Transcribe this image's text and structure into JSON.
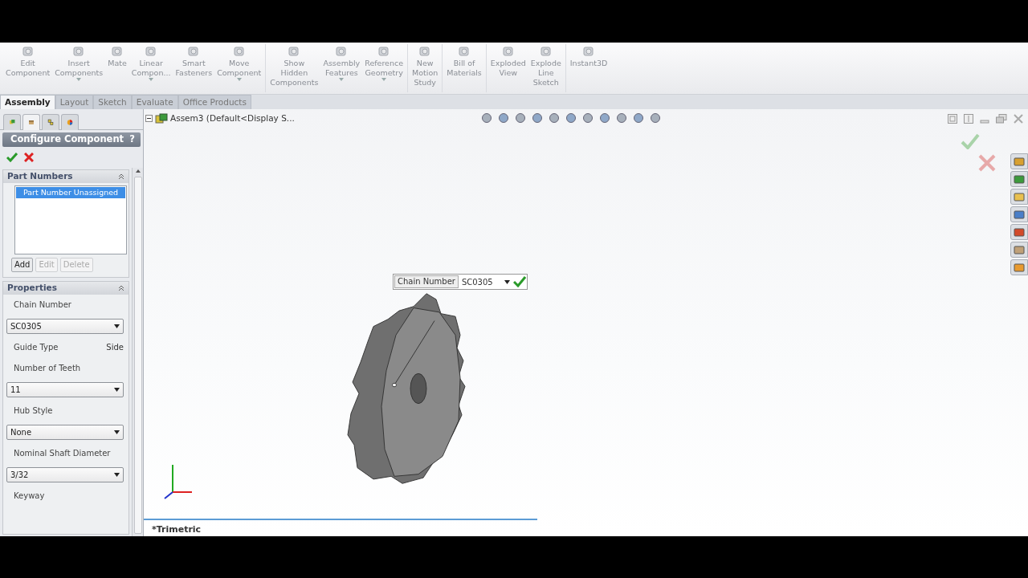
{
  "toolbar": {
    "buttons": [
      {
        "lines": [
          "Edit",
          "Component"
        ],
        "dropdown": false
      },
      {
        "lines": [
          "Insert",
          "Components"
        ],
        "dropdown": true
      },
      {
        "lines": [
          "Mate"
        ],
        "dropdown": false
      },
      {
        "lines": [
          "Linear",
          "Compon..."
        ],
        "dropdown": true
      },
      {
        "lines": [
          "Smart",
          "Fasteners"
        ],
        "dropdown": false
      },
      {
        "lines": [
          "Move",
          "Component"
        ],
        "dropdown": true
      },
      {
        "lines": [
          "Show",
          "Hidden",
          "Components"
        ],
        "dropdown": false
      },
      {
        "lines": [
          "Assembly",
          "Features"
        ],
        "dropdown": true
      },
      {
        "lines": [
          "Reference",
          "Geometry"
        ],
        "dropdown": true
      },
      {
        "lines": [
          "New",
          "Motion",
          "Study"
        ],
        "dropdown": false
      },
      {
        "lines": [
          "Bill of",
          "Materials"
        ],
        "dropdown": false
      },
      {
        "lines": [
          "Exploded",
          "View"
        ],
        "dropdown": false
      },
      {
        "lines": [
          "Explode",
          "Line",
          "Sketch"
        ],
        "dropdown": false
      },
      {
        "lines": [
          "Instant3D"
        ],
        "dropdown": false
      }
    ]
  },
  "command_tabs": [
    {
      "label": "Assembly",
      "selected": true
    },
    {
      "label": "Layout",
      "selected": false
    },
    {
      "label": "Sketch",
      "selected": false
    },
    {
      "label": "Evaluate",
      "selected": false
    },
    {
      "label": "Office Products",
      "selected": false
    }
  ],
  "panel_tabs": [
    {
      "selected": false
    },
    {
      "selected": true
    },
    {
      "selected": false
    },
    {
      "selected": false
    }
  ],
  "property_manager": {
    "title": "Configure Component",
    "help": "?",
    "part_numbers": {
      "title": "Part Numbers",
      "items": [
        {
          "label": "Part Number Unassigned",
          "selected": true
        }
      ],
      "buttons": [
        {
          "label": "Add",
          "disabled": false
        },
        {
          "label": "Edit",
          "disabled": true
        },
        {
          "label": "Delete",
          "disabled": true
        }
      ]
    },
    "properties": {
      "title": "Properties",
      "fields": [
        {
          "kind": "label",
          "label": "Chain Number"
        },
        {
          "kind": "select",
          "value": "SC0305"
        },
        {
          "kind": "pair",
          "label": "Guide Type",
          "value": "Side"
        },
        {
          "kind": "label",
          "label": "Number of Teeth"
        },
        {
          "kind": "select",
          "value": "11"
        },
        {
          "kind": "label",
          "label": "Hub Style"
        },
        {
          "kind": "select",
          "value": "None"
        },
        {
          "kind": "label",
          "label": "Nominal Shaft Diameter"
        },
        {
          "kind": "select",
          "value": "3/32"
        },
        {
          "kind": "label",
          "label": "Keyway"
        }
      ]
    }
  },
  "tree": {
    "root": "Assem3  (Default<Display S..."
  },
  "callout": {
    "label": "Chain Number",
    "value": "SC0305"
  },
  "view_label": "*Trimetric"
}
